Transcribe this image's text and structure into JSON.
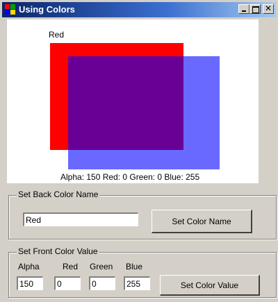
{
  "window": {
    "title": "Using Colors"
  },
  "canvas": {
    "red_label": "Red",
    "status": "Alpha: 150 Red: 0 Green: 0 Blue: 255",
    "colors": {
      "red_rect": "#ff0000",
      "blue_rect": "rgba(0,0,255,0.588)"
    }
  },
  "back_color_group": {
    "legend": "Set Back Color Name",
    "name_value": "Red",
    "button_label": "Set Color Name"
  },
  "front_color_group": {
    "legend": "Set Front Color Value",
    "labels": {
      "alpha": "Alpha",
      "red": "Red",
      "green": "Green",
      "blue": "Blue"
    },
    "values": {
      "alpha": "150",
      "red": "0",
      "green": "0",
      "blue": "255"
    },
    "button_label": "Set Color Value"
  },
  "icons": [
    "app-icon",
    "minimize-icon",
    "maximize-icon",
    "close-icon"
  ]
}
